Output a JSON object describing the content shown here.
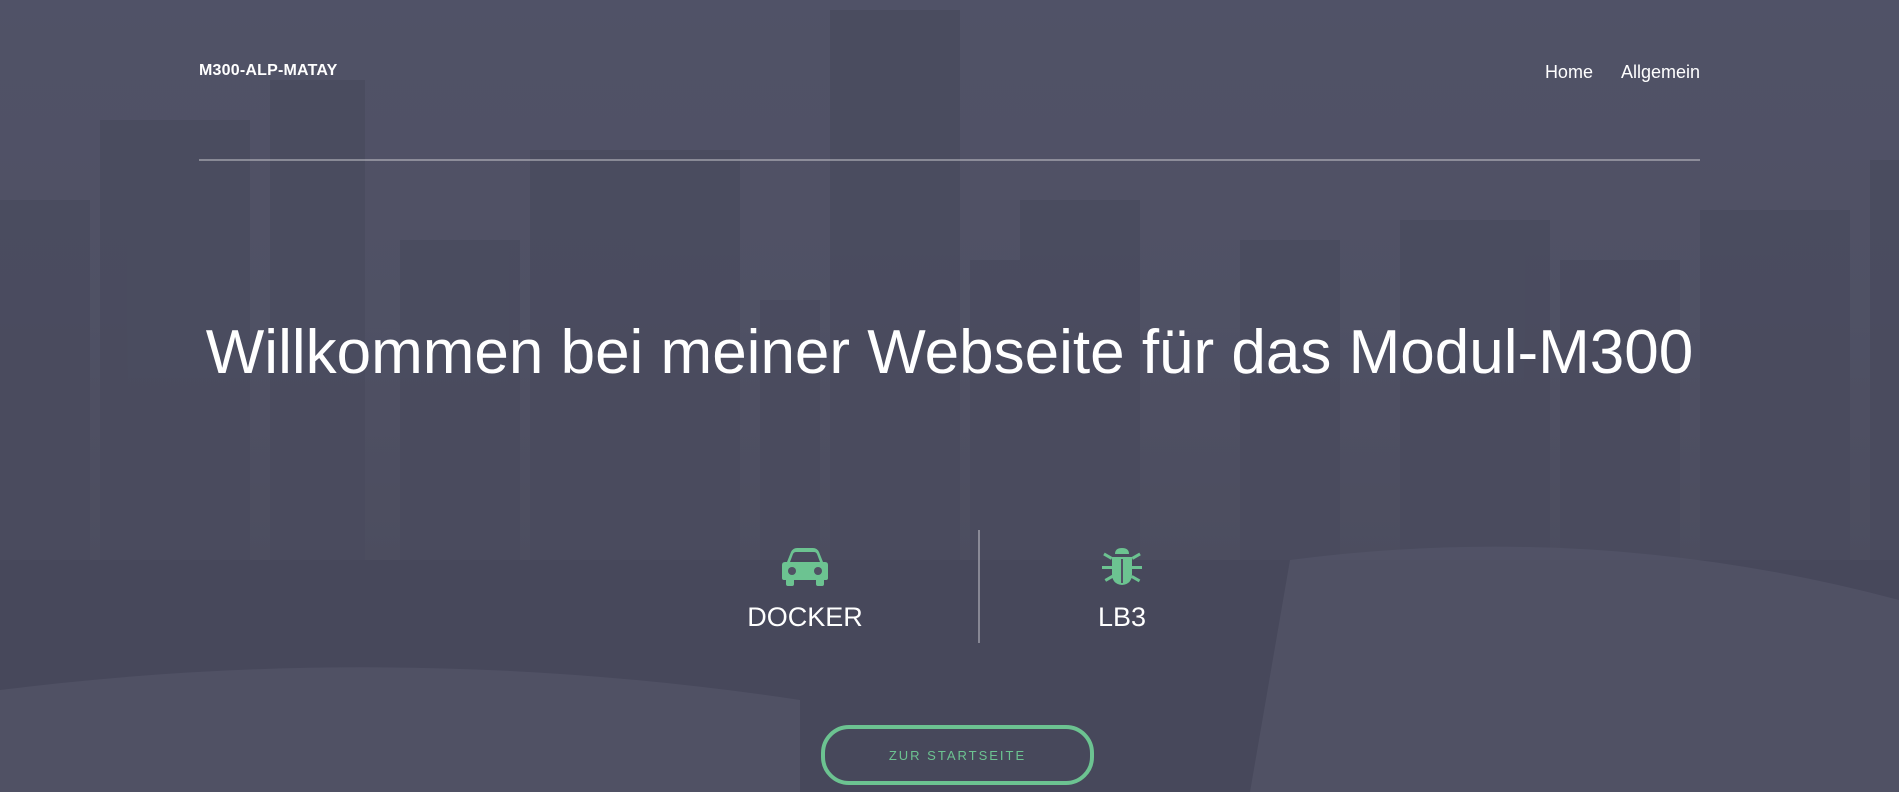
{
  "header": {
    "brand": "M300-ALP-MATAY",
    "nav": [
      {
        "label": "Home"
      },
      {
        "label": "Allgemein"
      }
    ]
  },
  "hero": {
    "title": "Willkommen bei meiner Webseite für das Modul-M300"
  },
  "features": [
    {
      "label": "DOCKER",
      "icon": "car-icon"
    },
    {
      "label": "LB3",
      "icon": "bug-icon"
    }
  ],
  "cta": {
    "label": "ZUR STARTSEITE"
  },
  "colors": {
    "accent": "#6cc391",
    "overlay": "#505164",
    "text": "#ffffff"
  }
}
